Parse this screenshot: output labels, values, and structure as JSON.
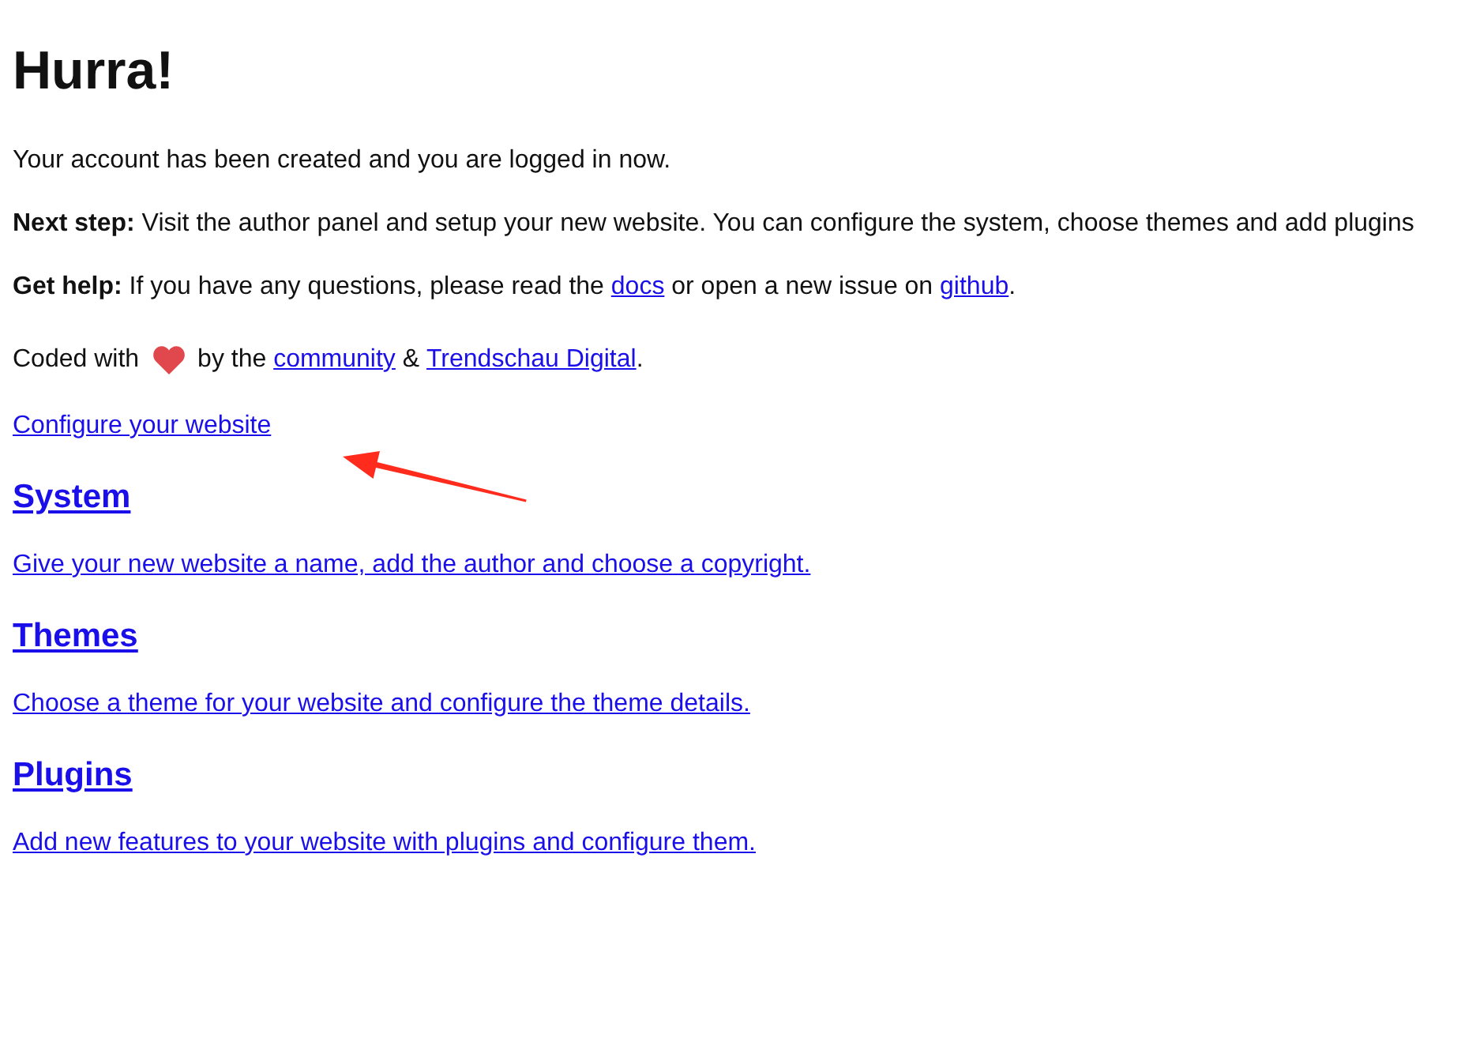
{
  "title": "Hurra!",
  "paragraphs": [
    {
      "segments": [
        {
          "kind": "text",
          "text": "Your account has been created and you are logged in now."
        }
      ]
    },
    {
      "segments": [
        {
          "kind": "text",
          "text": "**Next step:** Visit the author panel and setup your new website. You can configure the system, choose themes and add plugins"
        }
      ]
    },
    {
      "segments": [
        {
          "kind": "text",
          "text": "**Get help:** If you have any questions, please read the "
        },
        {
          "kind": "link",
          "text": "docs"
        },
        {
          "kind": "text",
          "text": " or open a new issue on "
        },
        {
          "kind": "link",
          "text": "github"
        },
        {
          "kind": "text",
          "text": "."
        }
      ]
    },
    {
      "segments": [
        {
          "kind": "text",
          "text": "Coded with"
        },
        {
          "kind": "heart"
        },
        {
          "kind": "text",
          "text": "by the "
        },
        {
          "kind": "link",
          "text": "community"
        },
        {
          "kind": "text",
          "text": " & "
        },
        {
          "kind": "link",
          "text": "Trendschau Digital"
        },
        {
          "kind": "text",
          "text": "."
        }
      ]
    }
  ],
  "configure_link": "Configure your website",
  "sections": [
    {
      "title": "System",
      "description": "Give your new website a name, add the author and choose a copyright."
    },
    {
      "title": "Themes",
      "description": "Choose a theme for your website and configure the theme details."
    },
    {
      "title": "Plugins",
      "description": "Add new features to your website with plugins and configure them."
    }
  ]
}
